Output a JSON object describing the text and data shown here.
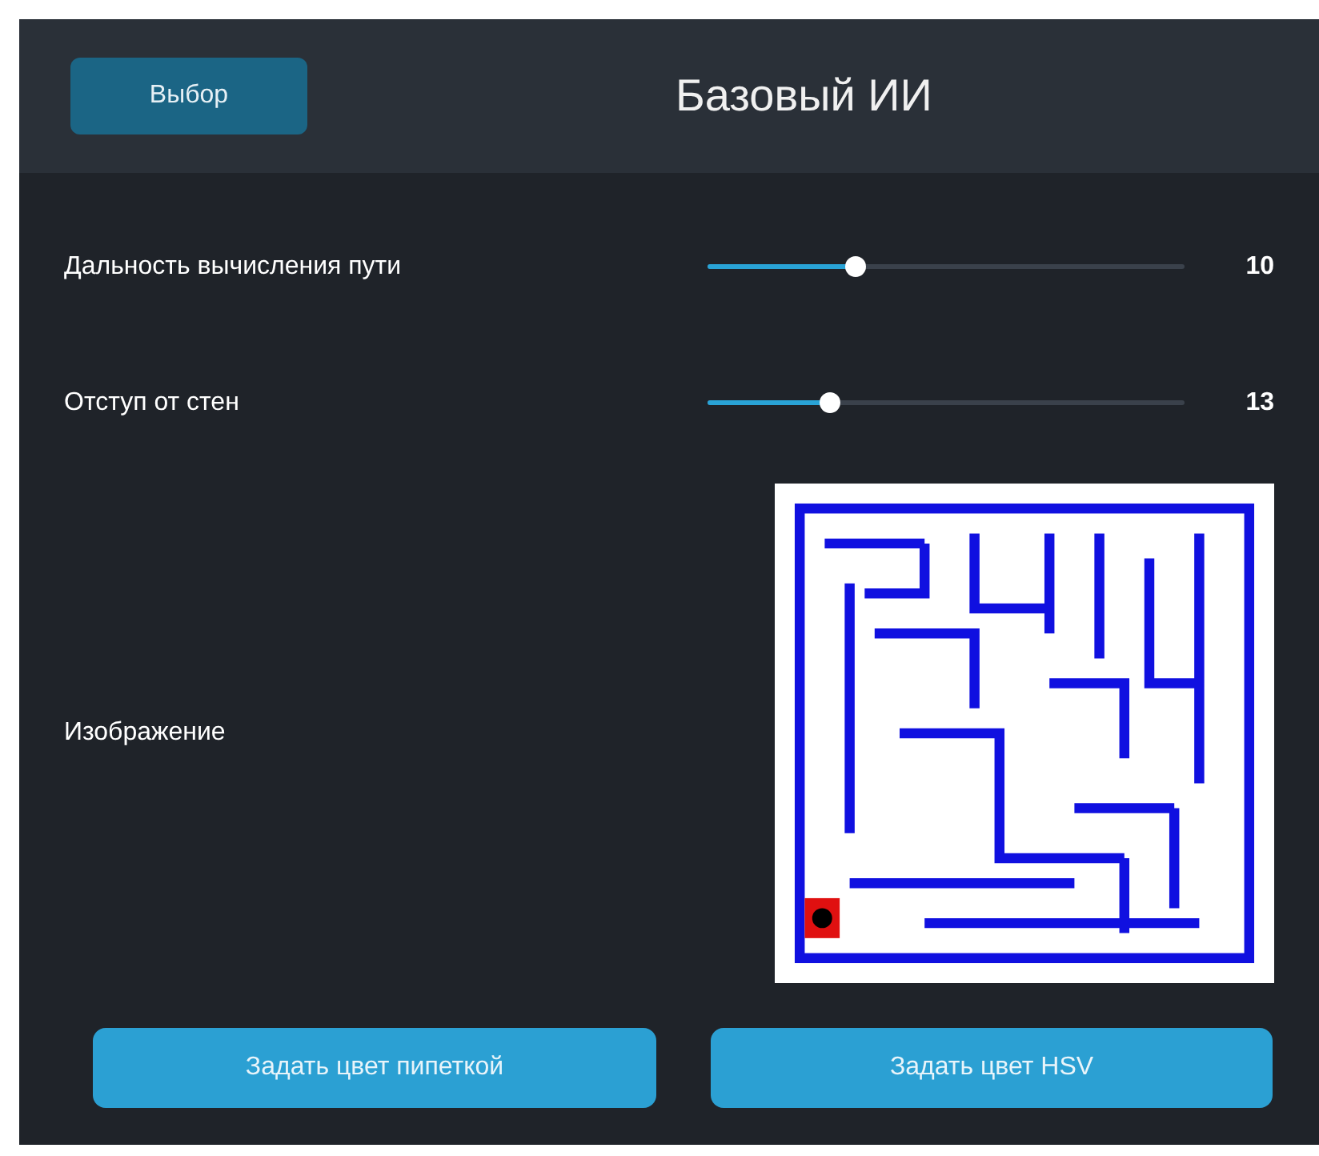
{
  "header": {
    "button": "Выбор",
    "title": "Базовый ИИ"
  },
  "sliders": [
    {
      "label": "Дальность вычисления пути",
      "level": 0.31,
      "reading": "10"
    },
    {
      "label": "Отступ от стен",
      "level": 0.255,
      "reading": "13"
    }
  ],
  "image": {
    "label": "Изображение",
    "kind": "picture"
  },
  "buttons": [
    "Задать цвет пипеткой",
    "Задать цвет HSV"
  ]
}
